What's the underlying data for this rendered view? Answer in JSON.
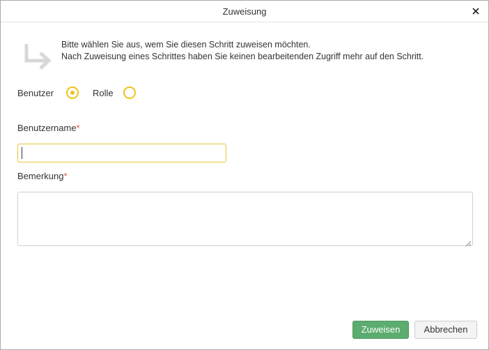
{
  "dialog": {
    "title": "Zuweisung",
    "close_icon": "close-icon"
  },
  "info": {
    "icon": "arrow-down-right-icon",
    "line1": "Bitte wählen Sie aus, wem Sie diesen Schritt zuweisen möchten.",
    "line2": "Nach Zuweisung eines Schrittes haben Sie keinen bearbeitenden Zugriff mehr auf den Schritt."
  },
  "assign_type": {
    "options": [
      {
        "label": "Benutzer",
        "selected": true
      },
      {
        "label": "Rolle",
        "selected": false
      }
    ]
  },
  "username": {
    "label": "Benutzername",
    "required_mark": "*",
    "value": ""
  },
  "remark": {
    "label": "Bemerkung",
    "required_mark": "*",
    "value": ""
  },
  "buttons": {
    "assign": "Zuweisen",
    "cancel": "Abbrechen"
  },
  "colors": {
    "accent_yellow": "#f0c419",
    "primary_green": "#5cac6f",
    "required_red": "#d9534f"
  }
}
